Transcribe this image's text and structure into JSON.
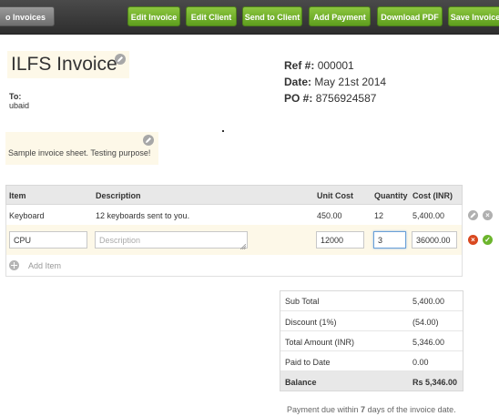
{
  "toolbar": {
    "back_label": "o Invoices",
    "edit_invoice": "Edit Invoice",
    "edit_client": "Edit Client",
    "send_to_client": "Send to Client",
    "add_payment": "Add Payment",
    "download_pdf": "Download PDF",
    "save_invoice": "Save Invoice"
  },
  "invoice": {
    "title": "ILFS Invoice",
    "to_label": "To:",
    "to_name": "ubaid",
    "ref_label": "Ref #:",
    "ref_value": "000001",
    "date_label": "Date:",
    "date_value": "May 21st 2014",
    "po_label": "PO #:",
    "po_value": "8756924587",
    "note": "Sample invoice sheet. Testing purpose!"
  },
  "table": {
    "headers": [
      "Item",
      "Description",
      "Unit Cost",
      "Quantity",
      "Cost (INR)"
    ],
    "rows": [
      {
        "item": "Keyboard",
        "description": "12 keyboards sent to you.",
        "unit_cost": "450.00",
        "quantity": "12",
        "cost": "5,400.00"
      }
    ],
    "edit_row": {
      "item": "CPU",
      "description_placeholder": "Description",
      "unit_cost": "12000",
      "quantity": "3",
      "cost": "36000.00"
    },
    "add_item_label": "Add Item"
  },
  "totals": {
    "sub_total_label": "Sub Total",
    "sub_total": "5,400.00",
    "discount_label": "Discount (1%)",
    "discount": "(54.00)",
    "total_label": "Total Amount (INR)",
    "total": "5,346.00",
    "paid_label": "Paid to Date",
    "paid": "0.00",
    "balance_label": "Balance",
    "balance": "Rs 5,346.00"
  },
  "footer": {
    "text_before": "Payment due within ",
    "days": "7",
    "text_after": " days of the invoice date."
  },
  "colors": {
    "button_green": "#6cb52d",
    "toolbar_dark": "#3a3a3a",
    "highlight_yellow": "#fdf8e8",
    "delete_red": "#d9481f"
  }
}
